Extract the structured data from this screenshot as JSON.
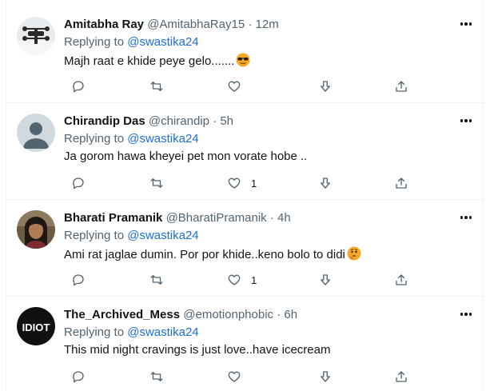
{
  "replying_to_label": "Replying to",
  "tweets": [
    {
      "name": "Amitabha Ray",
      "handle": "@AmitabhaRay15",
      "separator": "·",
      "time": "12m",
      "mention": "@swastika24",
      "text": "Majh raat e khide peye gelo.......",
      "emoji": "sunglasses-emoji",
      "like_count": ""
    },
    {
      "name": "Chirandip Das",
      "handle": "@chirandip",
      "separator": "·",
      "time": "5h",
      "mention": "@swastika24",
      "text": "Ja gorom hawa kheyei pet mon vorate hobe ..",
      "emoji": "",
      "like_count": "1"
    },
    {
      "name": "Bharati Pramanik",
      "handle": "@BharatiPramanik",
      "separator": "·",
      "time": "4h",
      "mention": "@swastika24",
      "text": "Ami rat jaglae dumin. Por por khide..keno bolo to didi",
      "emoji": "thinking-face-emoji",
      "like_count": "1"
    },
    {
      "name": "The_Archived_Mess",
      "handle": "@emotionphobic",
      "separator": "·",
      "time": "6h",
      "mention": "@swastika24",
      "text": "This mid night cravings is just love..have icecream",
      "emoji": "",
      "like_count": ""
    }
  ],
  "avatar_badge_text": "IDIOT",
  "colors": {
    "text": "#0f1419",
    "secondary": "#536471",
    "mention": "#1d6fd6",
    "divider": "#eff3f4"
  }
}
